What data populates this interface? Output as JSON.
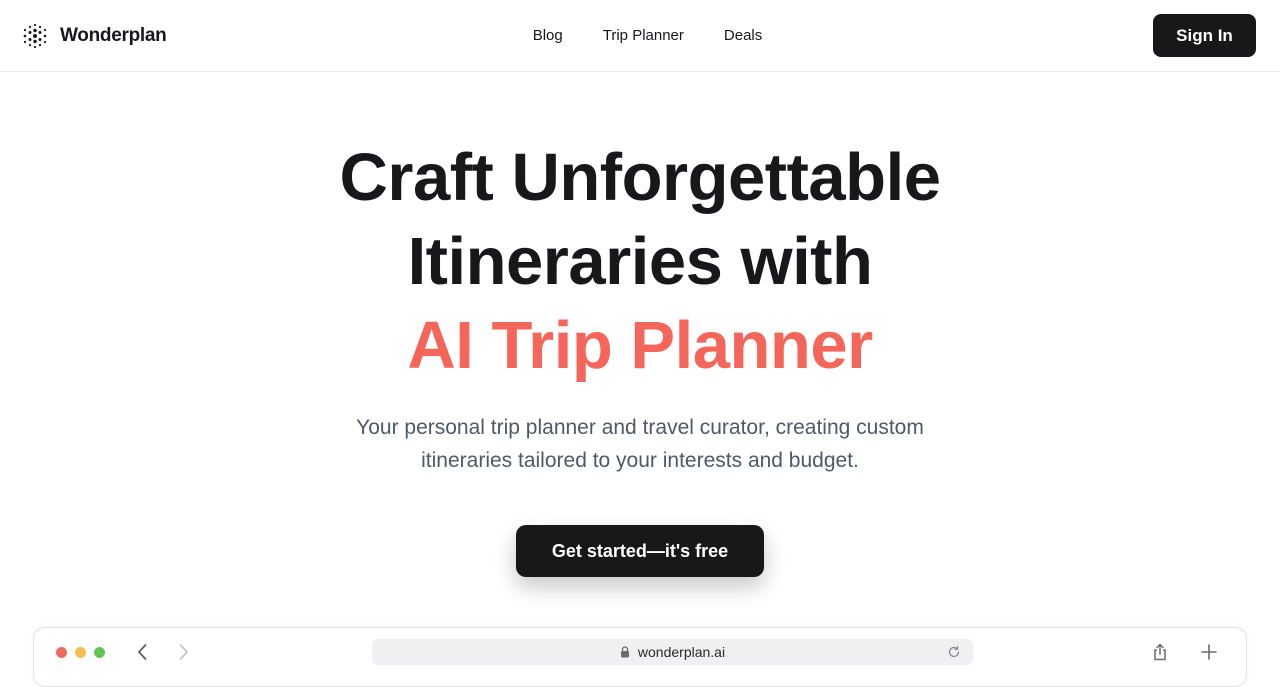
{
  "header": {
    "brand": "Wonderplan",
    "nav": [
      {
        "label": "Blog"
      },
      {
        "label": "Trip Planner"
      },
      {
        "label": "Deals"
      }
    ],
    "signin_label": "Sign In"
  },
  "hero": {
    "title_line1": "Craft Unforgettable",
    "title_line2": "Itineraries with",
    "title_accent": "AI Trip Planner",
    "subtitle_line1": "Your personal trip planner and travel curator, creating custom",
    "subtitle_line2": "itineraries tailored to your interests and budget.",
    "cta_label": "Get started—it's free"
  },
  "browser_mock": {
    "url": "wonderplan.ai"
  },
  "colors": {
    "accent": "#f4655a",
    "dark": "#18181b",
    "subtitle": "#515865"
  },
  "icons": [
    "wonderplan-logo-icon",
    "back-chevron-icon",
    "forward-chevron-icon",
    "lock-icon",
    "reload-icon",
    "share-icon",
    "plus-icon"
  ]
}
